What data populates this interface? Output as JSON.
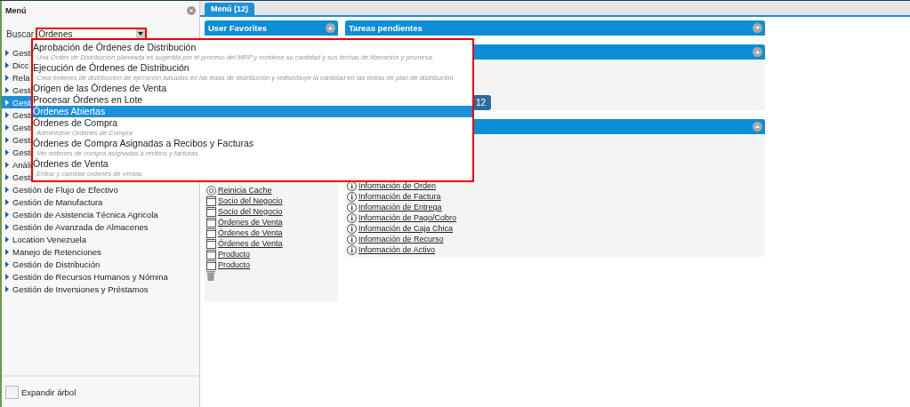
{
  "sidebar": {
    "title": "Menú",
    "search_label": "Buscar",
    "search_value": "Órdenes",
    "items": [
      {
        "label": "Gesti",
        "selected": false
      },
      {
        "label": "Dicc",
        "selected": false
      },
      {
        "label": "Rela",
        "selected": false
      },
      {
        "label": "Gesti",
        "selected": false
      },
      {
        "label": "Gesti",
        "selected": true
      },
      {
        "label": "Gesti",
        "selected": false
      },
      {
        "label": "Gesti",
        "selected": false
      },
      {
        "label": "Gesti",
        "selected": false
      },
      {
        "label": "Gesti",
        "selected": false
      },
      {
        "label": "Análi",
        "selected": false
      },
      {
        "label": "Gesti",
        "selected": false
      },
      {
        "label": "Gestión de Flujo de Efectivo",
        "selected": false
      },
      {
        "label": "Gestión de Manufactura",
        "selected": false
      },
      {
        "label": "Gestión de Asistencia Técnica Agricola",
        "selected": false
      },
      {
        "label": "Gestión de Avanzada de Almacenes",
        "selected": false
      },
      {
        "label": "Location Venezuela",
        "selected": false
      },
      {
        "label": "Manejo de Retenciones",
        "selected": false
      },
      {
        "label": "Gestión de Distribución",
        "selected": false
      },
      {
        "label": "Gestión de Recursos Humanos y Nómina",
        "selected": false
      },
      {
        "label": "Gestión de Inversiones y Préstamos",
        "selected": false
      }
    ],
    "expand_tree": {
      "label": "Expandir árbol",
      "checked": false
    }
  },
  "dropdown": {
    "items": [
      {
        "title": "Aprobación de Órdenes de Distribución",
        "description": "Una Orden de Distribución planeada es sugerida por el proceso del MRP y contiene su cantidad y sus fechas de liberación y promesa.",
        "selected": false
      },
      {
        "title": "Ejecución de Órdenes de Distribución",
        "description": "Crea órdenes de distribución de ejecución basadas en las listas de distribución y redistribuye la cantidad en las líneas de plan de distribución",
        "selected": false
      },
      {
        "title": "Origen de las Órdenes de Venta",
        "selected": false
      },
      {
        "title": "Procesar Órdenes en Lote",
        "selected": false
      },
      {
        "title": "Órdenes Abiertas",
        "selected": true
      },
      {
        "title": "Órdenes de Compra",
        "description": "Administrar Ordenes de Compra",
        "selected": false
      },
      {
        "title": "Órdenes de Compra Asignadas a Recibos y Facturas",
        "description": "Ver ordenes de compra asignadas a recibos y facturas",
        "selected": false
      },
      {
        "title": "Órdenes de Venta",
        "description": "Entrar y cambiar ordenes de ventas",
        "selected": false
      }
    ]
  },
  "tabs": [
    {
      "label": "Menú (12)",
      "selected": true
    }
  ],
  "favorites": {
    "title": "User Favorites",
    "expanded": true,
    "items": [
      {
        "kind": "refresh",
        "label": "Reinicia Cache"
      },
      {
        "kind": "window",
        "label": "Socio del Negocio"
      },
      {
        "kind": "window",
        "label": "Socio del Negocio"
      },
      {
        "kind": "window",
        "label": "Órdenes de Venta"
      },
      {
        "kind": "window",
        "label": "Órdenes de Venta"
      },
      {
        "kind": "window",
        "label": "Órdenes de Venta"
      },
      {
        "kind": "window",
        "label": "Producto"
      },
      {
        "kind": "window",
        "label": "Producto"
      },
      {
        "kind": "trash"
      }
    ]
  },
  "pending": {
    "title": "Tareas pendientes",
    "expanded": false
  },
  "panel_2": {
    "expanded": true,
    "button": "12"
  },
  "panel_3": {
    "expanded": true,
    "links": [
      "Información de Orden",
      "Información de Factura",
      "Información de Entrega",
      "Información de Pago/Cobro",
      "Información de Caja Chica",
      "Información de Recurso",
      "Información de Activo"
    ]
  }
}
